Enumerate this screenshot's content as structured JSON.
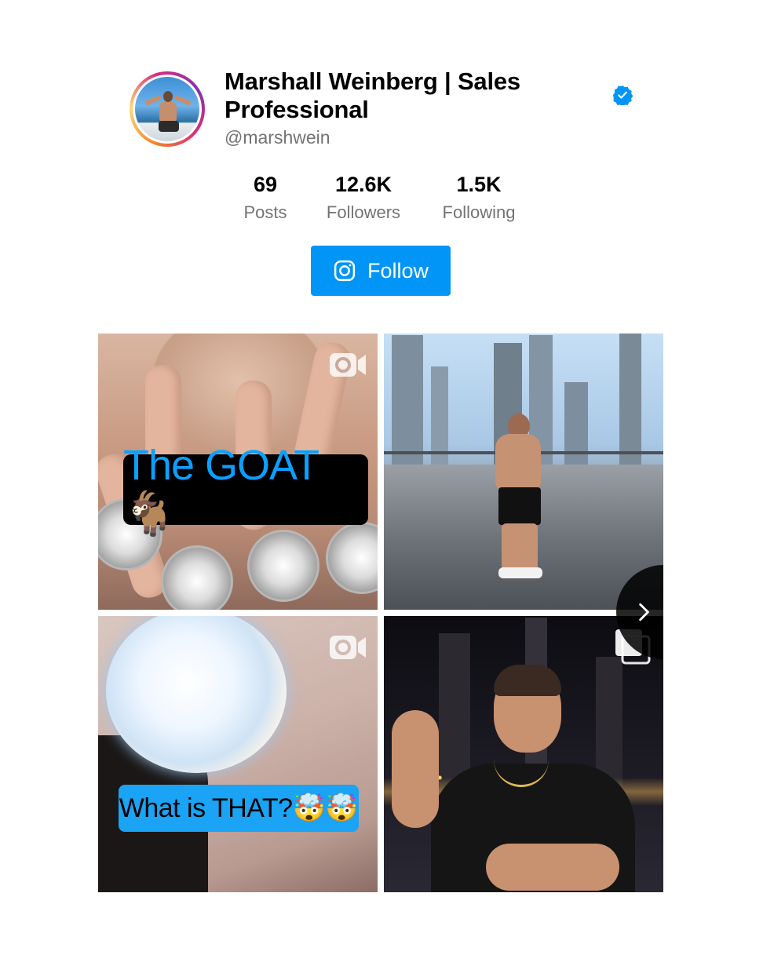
{
  "profile": {
    "name": "Marshall Weinberg | Sales Professional",
    "handle": "@marshwein",
    "verified": true,
    "avatar_icon": "profile-avatar",
    "ring_colors": [
      "#f58529",
      "#dd2a7b",
      "#8134af"
    ]
  },
  "stats": [
    {
      "value": "69",
      "label": "Posts"
    },
    {
      "value": "12.6K",
      "label": "Followers"
    },
    {
      "value": "1.5K",
      "label": "Following"
    }
  ],
  "follow_button": {
    "label": "Follow",
    "icon": "instagram-icon",
    "color": "#0095f6"
  },
  "posts": [
    {
      "type": "video",
      "caption": "The GOAT🐐",
      "icon": "video-camera-icon"
    },
    {
      "type": "photo",
      "caption": "",
      "icon": ""
    },
    {
      "type": "video",
      "caption": "What is THAT?🤯🤯",
      "icon": "video-camera-icon"
    },
    {
      "type": "carousel",
      "caption": "",
      "icon": "carousel-icon"
    }
  ],
  "navigation": {
    "next_icon": "chevron-right-icon"
  },
  "colors": {
    "accent": "#0095f6",
    "verified": "#0095f6",
    "muted_text": "#737373"
  }
}
